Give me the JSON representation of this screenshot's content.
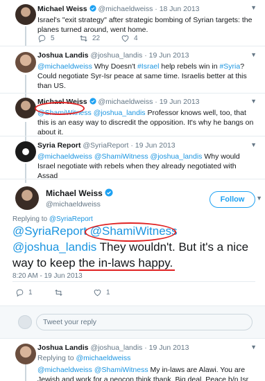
{
  "tweets": [
    {
      "name": "Michael Weiss",
      "handle": "@michaeldweiss",
      "date": "· 18 Jun 2013",
      "text": "Israel's \"exit strategy\" after strategic bombing of Syrian targets: the planes turned around, went home.",
      "replies": "5",
      "retweets": "22",
      "likes": "4"
    },
    {
      "name": "Joshua Landis",
      "handle": "@joshua_landis",
      "date": "· 19 Jun 2013",
      "mention": "@michaeldweiss",
      "text_a": " Why Doesn't ",
      "hashtag1": "#Israel",
      "text_b": " help rebels win in ",
      "hashtag2": "#Syria",
      "text_c": "? Could negotiate Syr-Isr peace at same time. Israelis better at this than US."
    },
    {
      "name": "Michael Weiss",
      "handle": "@michaeldweiss",
      "date": "· 19 Jun 2013",
      "mention1": "@ShamiWitness",
      "mention2": "@joshua_landis",
      "text": " Professor knows well, too, that this is an easy way to discredit the opposition. It's why he bangs on about it."
    },
    {
      "name": "Syria Report",
      "handle": "@SyriaReport",
      "date": "· 19 Jun 2013",
      "mentions": "@michaeldweiss @ShamiWitness @joshua_landis",
      "text": " Why would Israel negotiate with rebels when they already negotiated with Assad"
    }
  ],
  "focus": {
    "name": "Michael Weiss",
    "handle": "@michaeldweiss",
    "follow_label": "Follow",
    "replying_prefix": "Replying to ",
    "replying_to": "@SyriaReport",
    "mention1": "@SyriaReport",
    "mention2": "@ShamiWitness",
    "mention3": "@joshua_landis",
    "text_a": " They wouldn't. But it's a nice way to ",
    "text_b": "keep the in-laws happy",
    "text_c": ".",
    "timestamp": "8:20 AM - 19 Jun 2013",
    "replies": "1",
    "likes": "1"
  },
  "reply_placeholder": "Tweet your reply",
  "last_tweet": {
    "name": "Joshua Landis",
    "handle": "@joshua_landis",
    "date": "· 19 Jun 2013",
    "replying_prefix": "Replying to ",
    "replying_to": "@michaeldweiss",
    "mentions": "@michaeldweiss @ShamiWitness",
    "text": " My in-laws are Alawi. You are Jewish and work for a neocon think thank. Big deal. Peace b/n Isr and Syr is best"
  },
  "colors": {
    "link": "#1b95e0",
    "accent": "#1da1f2",
    "annotation": "#e02222",
    "muted": "#657786"
  },
  "icons": [
    "verified-badge-icon",
    "reply-icon",
    "retweet-icon",
    "like-icon",
    "caret-down-icon"
  ]
}
